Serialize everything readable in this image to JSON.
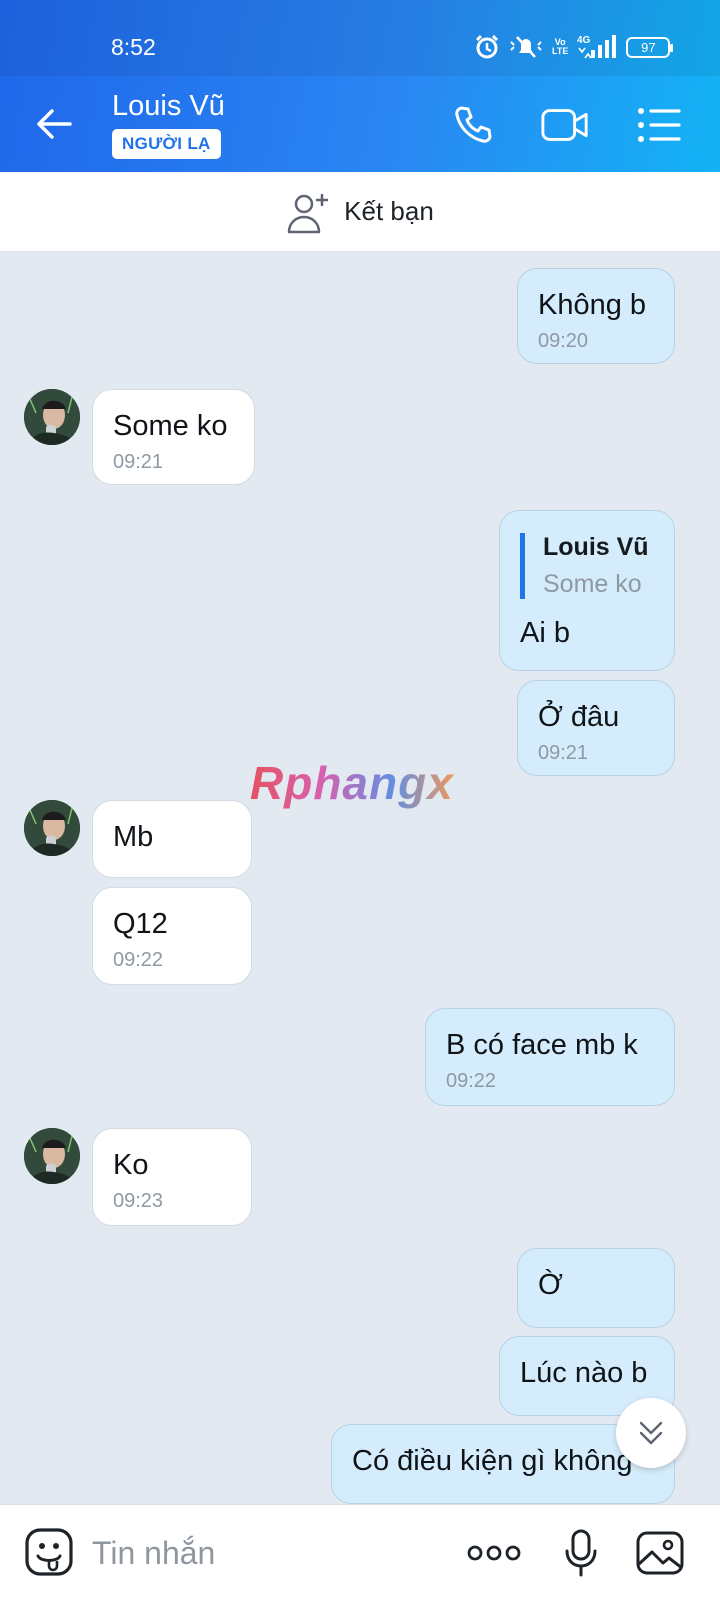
{
  "status_bar": {
    "time": "8:52",
    "network": "4G",
    "volte": "Vo\nLTE",
    "battery": "97"
  },
  "header": {
    "contact_name": "Louis Vũ",
    "badge": "NGƯỜI LẠ",
    "icons": [
      "back-arrow-icon",
      "phone-icon",
      "video-call-icon",
      "menu-list-icon"
    ]
  },
  "friend_bar": {
    "label": "Kết bạn",
    "icon": "add-friend-icon"
  },
  "messages": [
    {
      "side": "me",
      "text": "Không b",
      "time": "09:20"
    },
    {
      "side": "them",
      "text": "Some ko",
      "time": "09:21"
    },
    {
      "side": "me",
      "reply_to": {
        "name": "Louis Vũ",
        "text": "Some ko"
      },
      "text": "Ai b"
    },
    {
      "side": "me",
      "text": "Ở đâu",
      "time": "09:21"
    },
    {
      "side": "them",
      "text": "Mb"
    },
    {
      "side": "them",
      "text": "Q12",
      "time": "09:22"
    },
    {
      "side": "me",
      "text": "B có face mb k",
      "time": "09:22"
    },
    {
      "side": "them",
      "text": "Ko",
      "time": "09:23"
    },
    {
      "side": "me",
      "text": "Ờ"
    },
    {
      "side": "me",
      "text": "Lúc nào b"
    },
    {
      "side": "me",
      "text": "Có điều kiện gì không"
    }
  ],
  "watermark": "Rphangx",
  "composer": {
    "placeholder": "Tin nhắn",
    "icons": [
      "emoji-icon",
      "more-icon",
      "microphone-icon",
      "image-icon"
    ]
  },
  "colors": {
    "header_start": "#1f67ea",
    "header_end": "#13b3f5",
    "my_bubble": "#d4ecfb",
    "their_bubble": "#ffffff",
    "chat_bg": "#e2e9f1",
    "accent": "#1f74ea"
  }
}
